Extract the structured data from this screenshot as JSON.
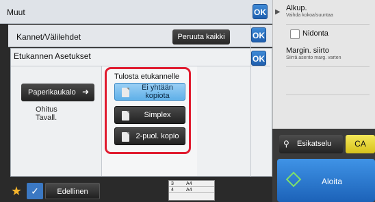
{
  "header": {
    "title": "Muut",
    "ok_label": "OK"
  },
  "covers": {
    "title": "Kannet/Välilehdet",
    "cancel_all_label": "Peruuta kaikki",
    "ok_label": "OK"
  },
  "front_cover_settings": {
    "title": "Etukannen Asetukset",
    "ok_label": "OK",
    "paper_tray_label": "Paperikaukalo",
    "paper_tray_value_line1": "Ohitus",
    "paper_tray_value_line2": "Tavall.",
    "print_on_cover_label": "Tulosta etukannelle",
    "options": [
      {
        "label": "Ei yhtään kopiota",
        "selected": true
      },
      {
        "label": "Simplex",
        "selected": false
      },
      {
        "label": "2-puol. kopio",
        "selected": false
      }
    ]
  },
  "status_panel": {
    "alkup_title": "Alkup.",
    "alkup_sub": "Vaihda kokoa/suuntaa",
    "nidonta_label": "Nidonta",
    "margin_title": "Margin. siirto",
    "margin_sub": "Siirrä asento marg. varten"
  },
  "bottom_bar": {
    "previous_label": "Edellinen",
    "tray_rows": [
      {
        "num": "3",
        "size": "A4"
      },
      {
        "num": "4",
        "size": "A4"
      }
    ]
  },
  "actions": {
    "preview_label": "Esikatselu",
    "ca_label": "CA",
    "start_label": "Aloita"
  },
  "colors": {
    "accent_blue": "#2a74c4",
    "highlight_red": "#e01b2f",
    "ca_yellow": "#e8d83a",
    "selected_option": "#6bb6ea"
  }
}
